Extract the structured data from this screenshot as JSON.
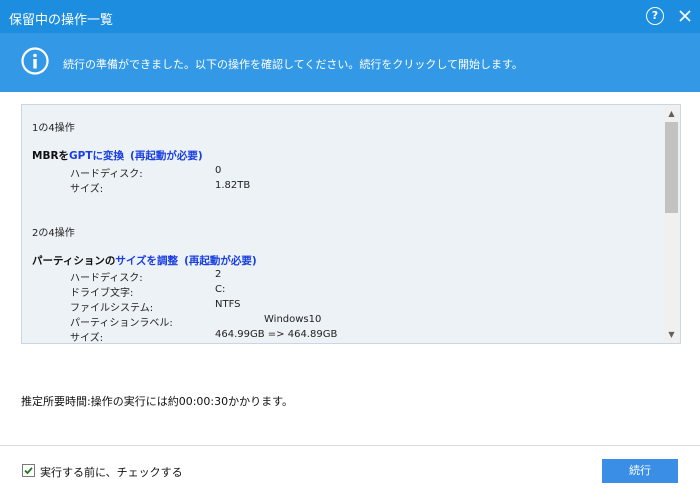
{
  "window": {
    "title": "保留中の操作一覧",
    "help_label": "?"
  },
  "banner": {
    "message": "続行の準備ができました。以下の操作を確認してください。続行をクリックして開始します。"
  },
  "operations": [
    {
      "header": "1の4操作",
      "title": {
        "prefix": "MBRを",
        "action": "GPTに変換",
        "suffix": "(再起動が必要)"
      },
      "details": [
        {
          "label": "ハードディスク:",
          "value": "0"
        },
        {
          "label": "サイズ:",
          "value": "1.82TB"
        }
      ]
    },
    {
      "header": "2の4操作",
      "title": {
        "prefix": "パーティションの",
        "action": "サイズを調整",
        "suffix": "(再起動が必要)"
      },
      "details": [
        {
          "label": "ハードディスク:",
          "value": "2"
        },
        {
          "label": "ドライブ文字:",
          "value": "C:"
        },
        {
          "label": "ファイルシステム:",
          "value": "NTFS"
        },
        {
          "label": "パーティションラベル:",
          "value": "Windows10"
        },
        {
          "label": "サイズ:",
          "value": "464.99GB => 464.89GB"
        }
      ]
    }
  ],
  "estimate": "推定所要時間:操作の実行には約00:00:30かかります。",
  "footer": {
    "checkbox_label": "実行する前に、チェックする",
    "checkbox_checked": true,
    "continue_label": "続行"
  },
  "colors": {
    "titlebar": "#1d8de0",
    "banner": "#3399e6",
    "action_blue": "#1a3fe0",
    "button": "#3a8ee6"
  }
}
